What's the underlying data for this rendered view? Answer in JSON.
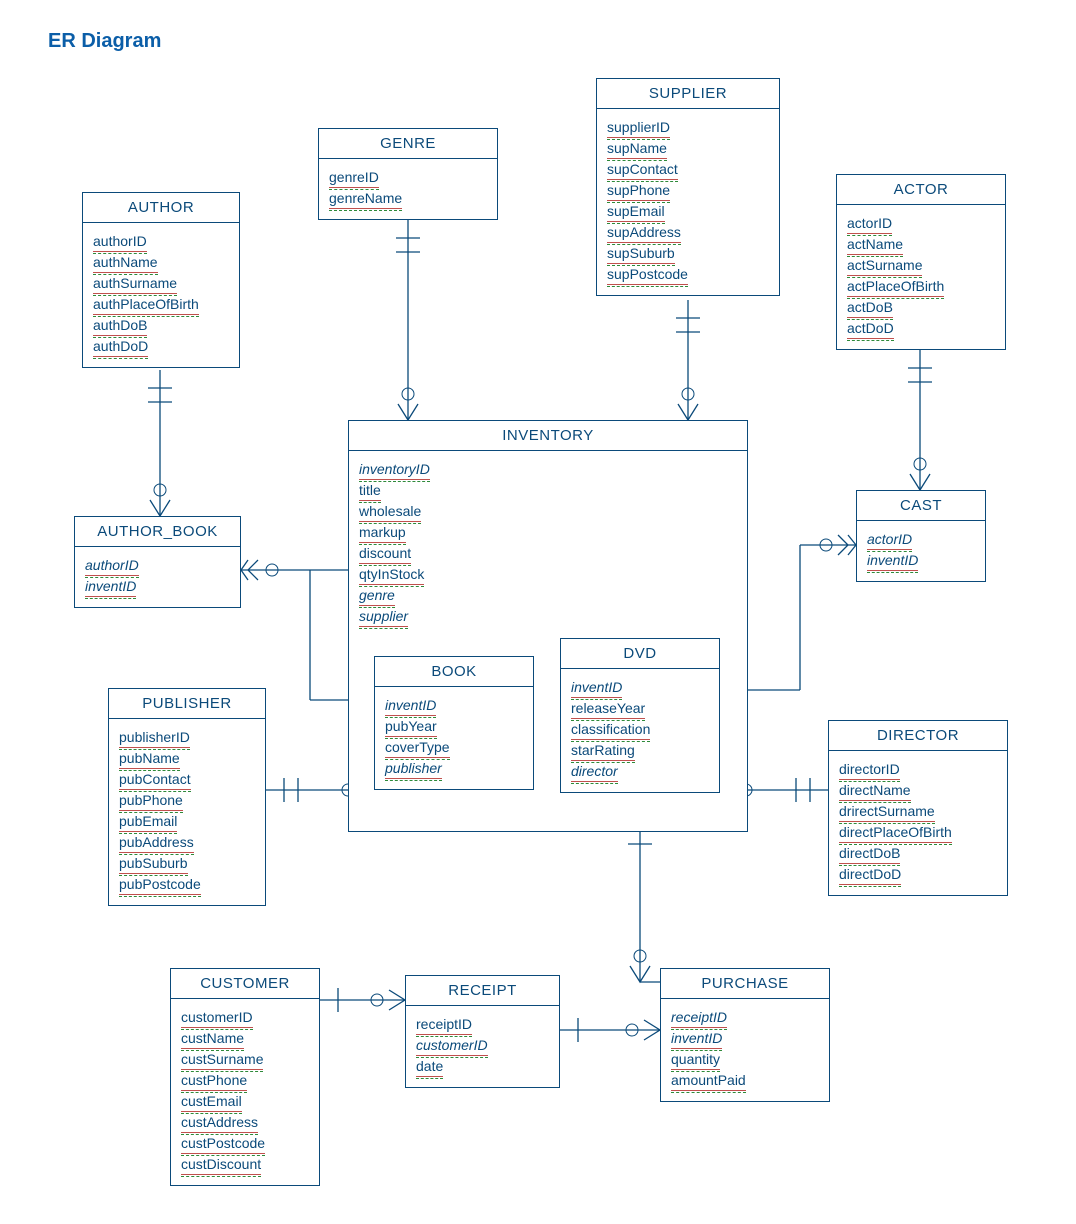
{
  "page_title": "ER Diagram",
  "entities": {
    "author": {
      "name": "AUTHOR",
      "attrs": [
        "authorID",
        "authName",
        "authSurname",
        "authPlaceOfBirth",
        "authDoB",
        "authDoD"
      ]
    },
    "author_book": {
      "name": "AUTHOR_BOOK",
      "attrs_fk": [
        "authorID",
        "inventID"
      ]
    },
    "genre": {
      "name": "GENRE",
      "attrs": [
        "genreID",
        "genreName"
      ]
    },
    "supplier": {
      "name": "SUPPLIER",
      "attrs": [
        "supplierID",
        "supName",
        "supContact",
        "supPhone",
        "supEmail",
        "supAddress",
        "supSuburb",
        "supPostcode"
      ]
    },
    "actor": {
      "name": "ACTOR",
      "attrs": [
        "actorID",
        "actName",
        "actSurname",
        "actPlaceOfBirth",
        "actDoB",
        "actDoD"
      ]
    },
    "cast": {
      "name": "CAST",
      "attrs_fk": [
        "actorID",
        "inventID"
      ]
    },
    "inventory": {
      "name": "INVENTORY",
      "attrs_fk_first": "inventoryID",
      "attrs": [
        "title",
        "wholesale",
        "markup",
        "discount",
        "qtyInStock"
      ],
      "attrs_fk_tail": [
        "genre",
        "supplier"
      ]
    },
    "book": {
      "name": "BOOK",
      "attr_fk_first": "inventID",
      "attrs": [
        "pubYear",
        "coverType"
      ],
      "attr_fk_last": "publisher"
    },
    "dvd": {
      "name": "DVD",
      "attr_fk_first": "inventID",
      "attrs": [
        "releaseYear",
        "classification",
        "starRating"
      ],
      "attr_fk_last": "director"
    },
    "publisher": {
      "name": "PUBLISHER",
      "attrs": [
        "publisherID",
        "pubName",
        "pubContact",
        "pubPhone",
        "pubEmail",
        "pubAddress",
        "pubSuburb",
        "pubPostcode"
      ]
    },
    "director": {
      "name": "DIRECTOR",
      "attrs": [
        "directorID",
        "directName",
        "drirectSurname",
        "directPlaceOfBirth",
        "directDoB",
        "directDoD"
      ]
    },
    "customer": {
      "name": "CUSTOMER",
      "attrs": [
        "customerID",
        "custName",
        "custSurname",
        "custPhone",
        "custEmail",
        "custAddress",
        "custPostcode",
        "custDiscount"
      ]
    },
    "receipt": {
      "name": "RECEIPT",
      "attrs": [
        "receiptID"
      ],
      "attrs_fk": [
        "customerID"
      ],
      "attrs2": [
        "date"
      ]
    },
    "purchase": {
      "name": "PURCHASE",
      "attrs_fk": [
        "receiptID",
        "inventID"
      ],
      "attrs": [
        "quantity",
        "amountPaid"
      ]
    }
  },
  "relationships": [
    {
      "from": "AUTHOR",
      "to": "AUTHOR_BOOK",
      "card": "one-to-many"
    },
    {
      "from": "AUTHOR_BOOK",
      "to": "BOOK",
      "card": "many-optional-to-one"
    },
    {
      "from": "GENRE",
      "to": "INVENTORY",
      "card": "one-to-many"
    },
    {
      "from": "SUPPLIER",
      "to": "INVENTORY",
      "card": "one-to-many"
    },
    {
      "from": "ACTOR",
      "to": "CAST",
      "card": "one-to-many"
    },
    {
      "from": "CAST",
      "to": "DVD",
      "card": "many-optional-to-one"
    },
    {
      "from": "BOOK",
      "to": "INVENTORY",
      "card": "subset"
    },
    {
      "from": "DVD",
      "to": "INVENTORY",
      "card": "subset"
    },
    {
      "from": "PUBLISHER",
      "to": "BOOK",
      "card": "one-to-many-optional"
    },
    {
      "from": "DIRECTOR",
      "to": "DVD",
      "card": "one-to-many-optional"
    },
    {
      "from": "DVD",
      "to": "PURCHASE",
      "card": "one-to-many"
    },
    {
      "from": "RECEIPT",
      "to": "PURCHASE",
      "card": "one-to-many-optional"
    },
    {
      "from": "CUSTOMER",
      "to": "RECEIPT",
      "card": "one-to-many-optional"
    }
  ]
}
